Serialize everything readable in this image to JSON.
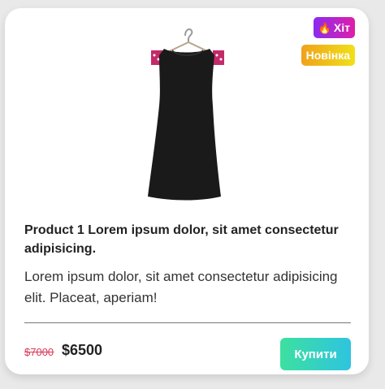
{
  "badges": {
    "hit_label": "Хіт",
    "hit_icon": "fire-icon",
    "new_label": "Новінка"
  },
  "product": {
    "title": "Product 1 Lorem ipsum dolor, sit amet consectetur adipisicing.",
    "description": "Lorem ipsum dolor, sit amet consectetur adipisicing elit. Placeat, aperiam!",
    "old_price": "$7000",
    "new_price": "$6500",
    "buy_label": "Купити"
  },
  "colors": {
    "hit_badge": "#8a2bf0",
    "new_badge": "#f0a21a",
    "old_price": "#d63a5a",
    "buy_button": "#3de0a0"
  }
}
